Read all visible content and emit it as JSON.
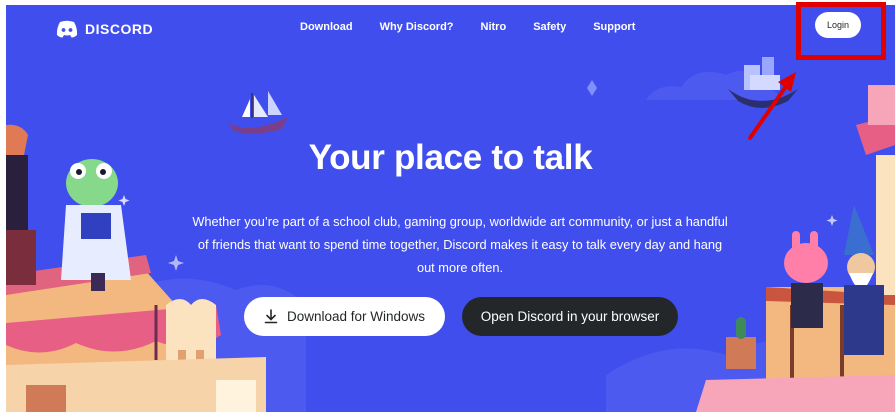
{
  "brand": {
    "name": "DISCORD",
    "icon": "discord-logo-icon"
  },
  "nav": {
    "items": [
      {
        "label": "Download"
      },
      {
        "label": "Why Discord?"
      },
      {
        "label": "Nitro"
      },
      {
        "label": "Safety"
      },
      {
        "label": "Support"
      }
    ],
    "login_label": "Login"
  },
  "hero": {
    "title": "Your place to talk",
    "description": "Whether you’re part of a school club, gaming group, worldwide art community, or just a handful of friends that want to spend time together, Discord makes it easy to talk every day and hang out more often.",
    "download_button": {
      "label": "Download for Windows",
      "icon": "download-icon"
    },
    "browser_button": {
      "label": "Open Discord in your browser"
    }
  },
  "colors": {
    "hero_background": "#404eed",
    "dark_button": "#23272a",
    "annotation_red": "#e00000"
  }
}
